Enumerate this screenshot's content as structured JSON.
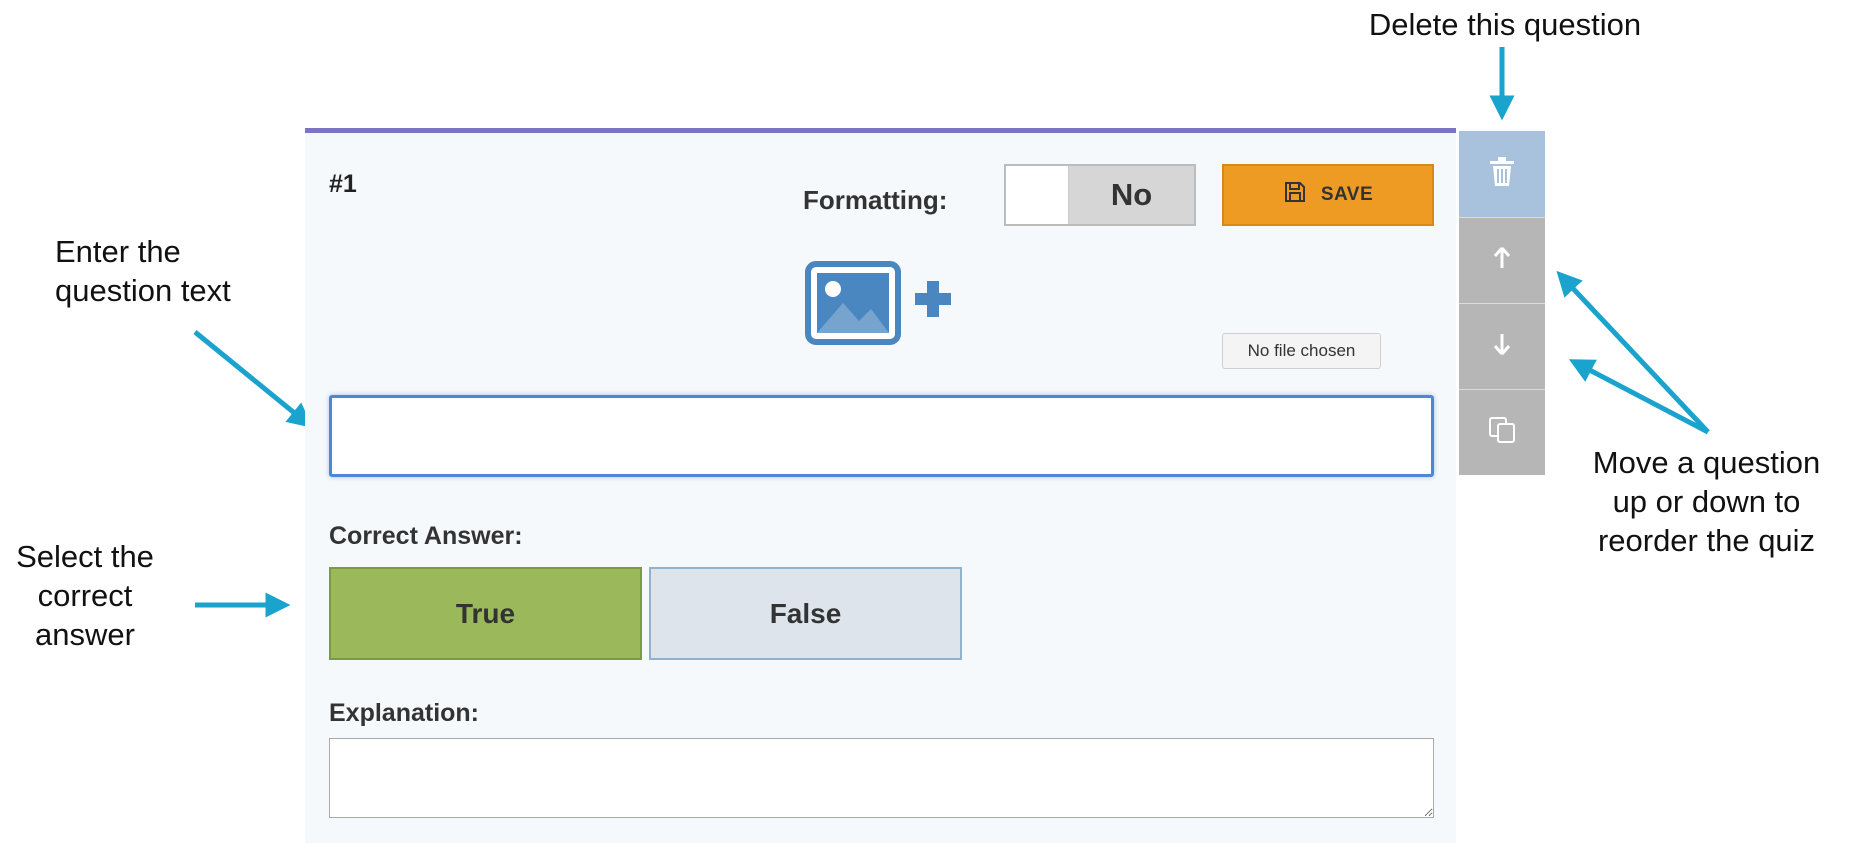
{
  "annotations": {
    "delete": "Delete this question",
    "question_line1": "Enter the",
    "question_line2": "question text",
    "correct_line1": "Select the",
    "correct_line2": "correct",
    "correct_line3": "answer",
    "move_line1": "Move a question",
    "move_line2": "up or down to",
    "move_line3": "reorder the quiz"
  },
  "question": {
    "number": "#1",
    "formatting_label": "Formatting:",
    "formatting_value": "No",
    "save_label": "SAVE",
    "file_chip": "No file chosen",
    "question_text_value": "",
    "correct_answer_label": "Correct Answer:",
    "answers": [
      "True",
      "False"
    ],
    "selected_answer": "True",
    "explanation_label": "Explanation:",
    "explanation_value": ""
  },
  "icons": {
    "save": "floppy-disk-icon",
    "image": "add-image-icon",
    "delete": "trash-icon",
    "up": "arrow-up-icon",
    "down": "arrow-down-icon",
    "duplicate": "duplicate-icon"
  },
  "colors": {
    "card_top_border": "#7b73c4",
    "save_button": "#ed9b22",
    "true_selected": "#9bb85a",
    "false_bg": "#dde4ec",
    "annotation_arrow": "#1aa3cc",
    "delete_button": "#a8c1dd",
    "side_buttons": "#b6b6b6",
    "image_icon": "#4a86bf"
  }
}
